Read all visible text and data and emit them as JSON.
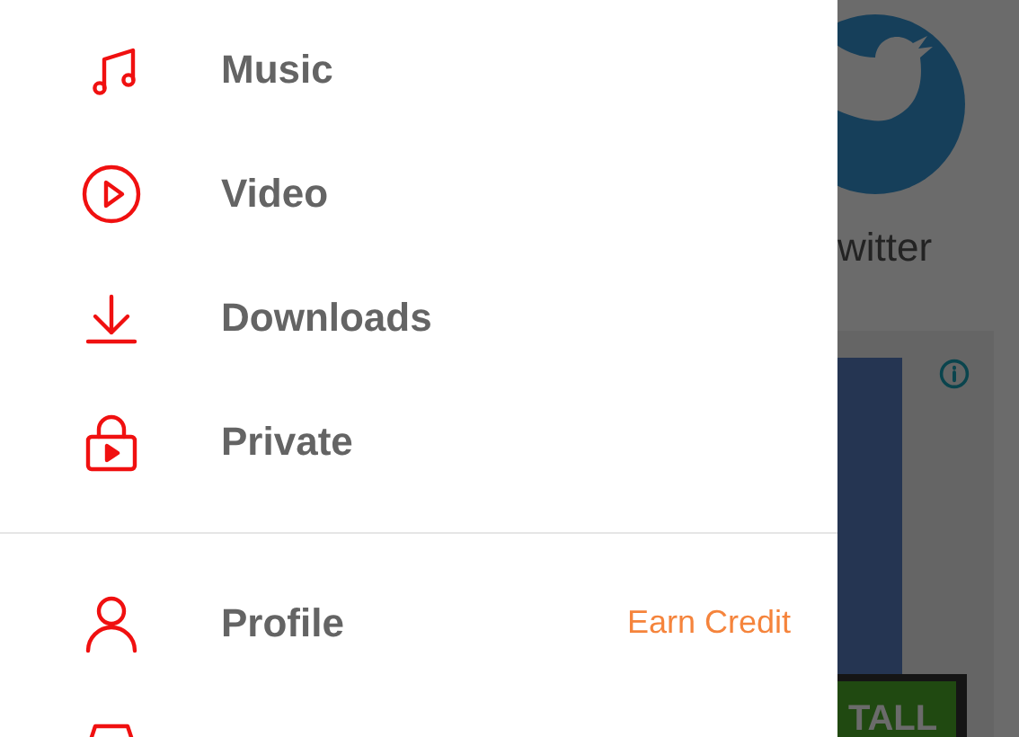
{
  "drawer": {
    "sections": [
      {
        "items": [
          {
            "kind": "music",
            "label": "Music"
          },
          {
            "kind": "video",
            "label": "Video"
          },
          {
            "kind": "download",
            "label": "Downloads"
          },
          {
            "kind": "lock",
            "label": "Private"
          }
        ]
      },
      {
        "items": [
          {
            "kind": "person",
            "label": "Profile",
            "note": "Earn Credit"
          },
          {
            "kind": "tray"
          }
        ]
      }
    ]
  },
  "background": {
    "app_label": "witter",
    "ad": {
      "button": "TALL"
    }
  }
}
